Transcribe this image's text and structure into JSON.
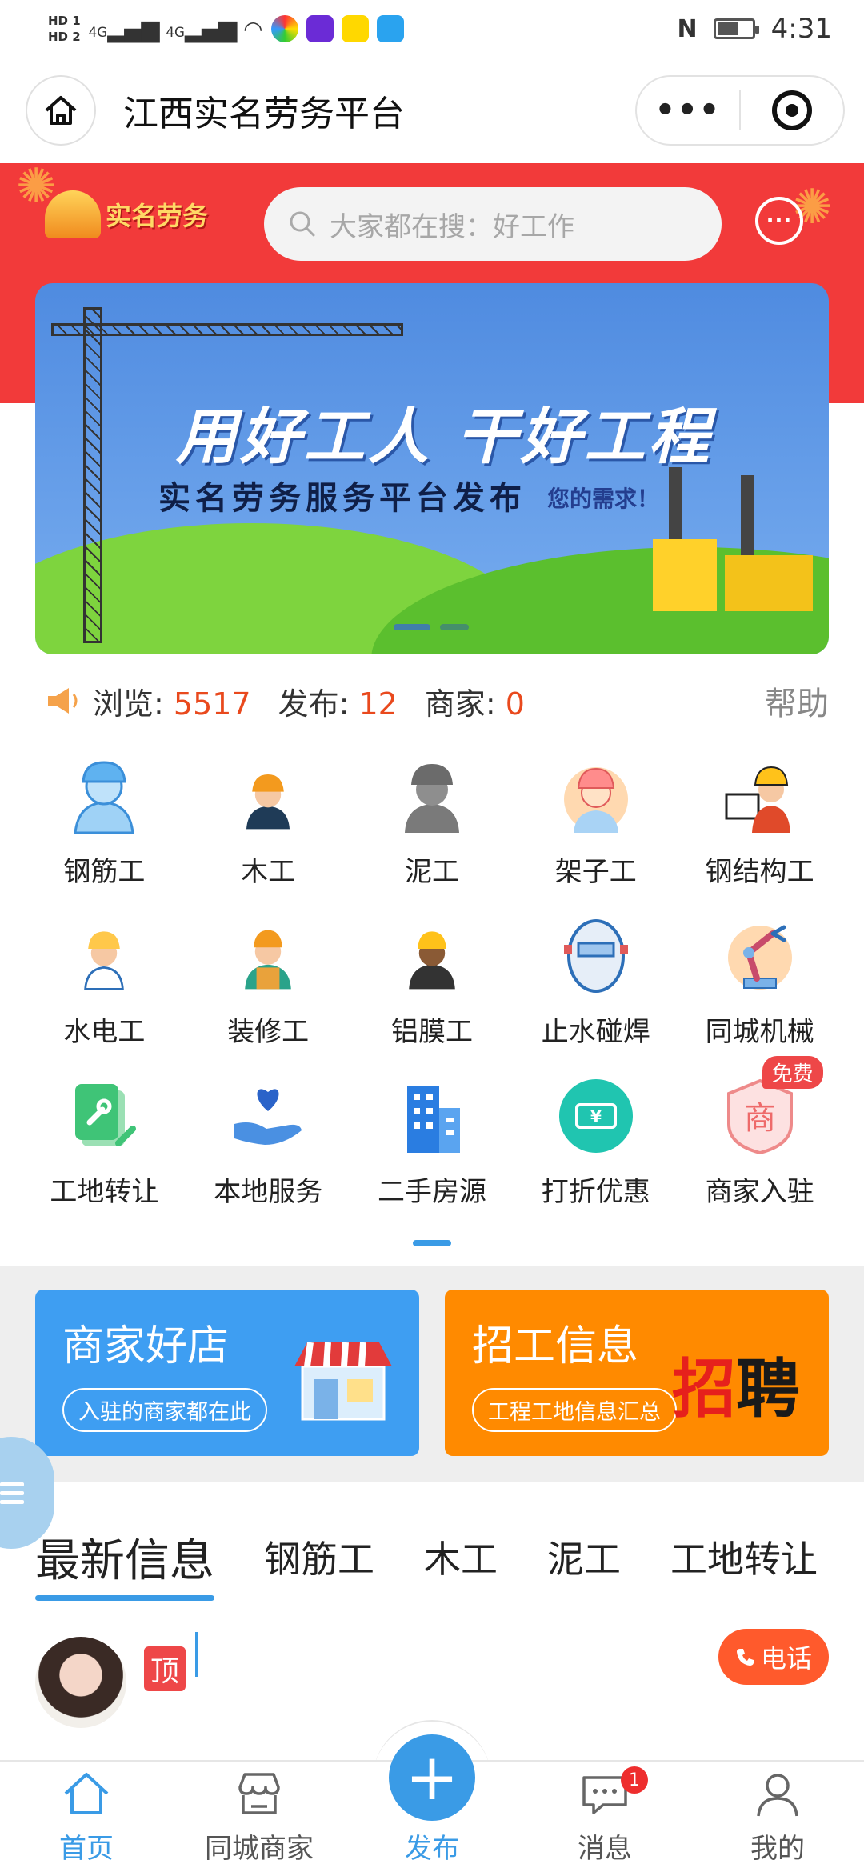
{
  "status_bar": {
    "hd1": "HD 1",
    "hd2": "HD 2",
    "net1": "4G",
    "net2": "4G",
    "time": "4:31",
    "battery_level": 0.6
  },
  "title_bar": {
    "title": "江西实名劳务平台",
    "more_icon": "more-dots-icon",
    "close_icon": "target-icon"
  },
  "header": {
    "logo_text": "实名劳务",
    "search_placeholder": "大家都在搜：好工作",
    "chat_icon": "chat-bubble-icon"
  },
  "banner": {
    "headline": "用好工人 干好工程",
    "subline": "实名劳务服务平台发布",
    "subline_suffix": "您的需求！",
    "slides": 2,
    "active_slide": 1
  },
  "stats": {
    "views_label": "浏览: ",
    "views": "5517",
    "posts_label": "发布: ",
    "posts": "12",
    "merchants_label": "商家: ",
    "merchants": "0",
    "help": "帮助"
  },
  "categories": [
    {
      "label": "钢筋工",
      "icon": "rebar-worker-icon"
    },
    {
      "label": "木工",
      "icon": "carpenter-icon"
    },
    {
      "label": "泥工",
      "icon": "mason-icon"
    },
    {
      "label": "架子工",
      "icon": "scaffolder-icon"
    },
    {
      "label": "钢结构工",
      "icon": "steel-worker-icon"
    },
    {
      "label": "水电工",
      "icon": "plumber-electrician-icon"
    },
    {
      "label": "装修工",
      "icon": "decorator-icon"
    },
    {
      "label": "铝膜工",
      "icon": "aluminum-formwork-icon"
    },
    {
      "label": "止水碰焊",
      "icon": "welding-mask-icon"
    },
    {
      "label": "同城机械",
      "icon": "robot-arm-icon"
    },
    {
      "label": "工地转让",
      "icon": "wrench-doc-icon"
    },
    {
      "label": "本地服务",
      "icon": "heart-hand-icon"
    },
    {
      "label": "二手房源",
      "icon": "building-icon"
    },
    {
      "label": "打折优惠",
      "icon": "coupon-icon"
    },
    {
      "label": "商家入驻",
      "icon": "shop-badge-icon",
      "badge": "免费"
    }
  ],
  "promo": {
    "left": {
      "title": "商家好店",
      "subtitle": "入驻的商家都在此"
    },
    "right": {
      "title": "招工信息",
      "subtitle": "工程工地信息汇总",
      "art_char1": "招",
      "art_char2": "聘"
    }
  },
  "tabs": [
    "最新信息",
    "钢筋工",
    "木工",
    "泥工",
    "工地转让"
  ],
  "list": {
    "top_badge": "顶",
    "phone_label": "电话"
  },
  "bottom_nav": [
    {
      "label": "首页",
      "icon": "home-icon"
    },
    {
      "label": "同城商家",
      "icon": "store-icon"
    },
    {
      "label": "发布",
      "icon": "plus-icon"
    },
    {
      "label": "消息",
      "icon": "message-icon",
      "badge": "1"
    },
    {
      "label": "我的",
      "icon": "user-icon"
    }
  ],
  "colors": {
    "accent": "#3a9be6",
    "header_red": "#f23a3a",
    "highlight_number": "#e9491d",
    "promo_blue": "#3e9ef2",
    "promo_orange": "#ff8a00"
  }
}
